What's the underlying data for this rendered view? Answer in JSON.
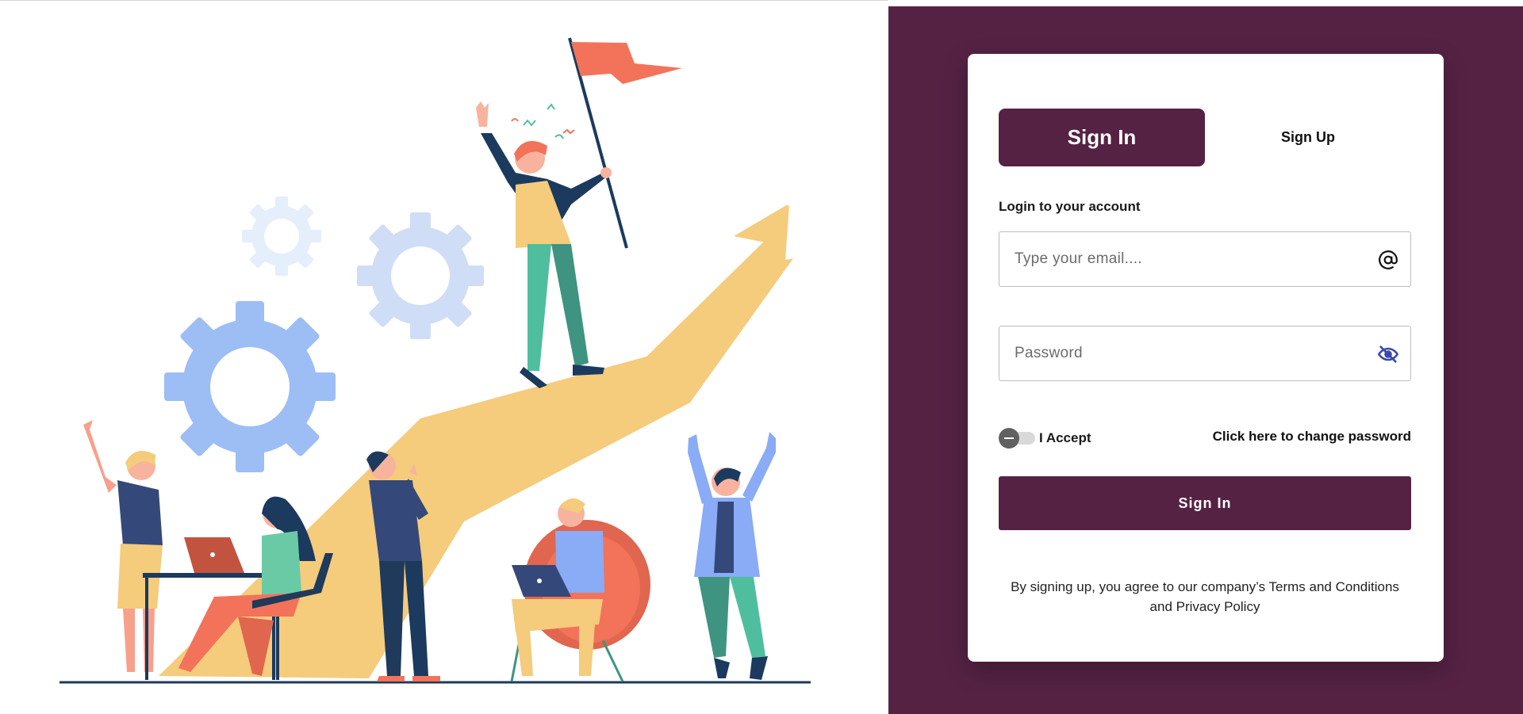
{
  "illustration": {
    "description_icon": "team-celebrating-growth-illustration",
    "colors": {
      "arrow": "#F5CB7C",
      "gear_dark": "#9DBDF5",
      "gear_light": "#CFDDF7",
      "flag": "#F2735A",
      "navy": "#1B3A5E",
      "green": "#4FBE9F",
      "ground": "#1F3A5A"
    }
  },
  "auth_card": {
    "tabs": {
      "sign_in": "Sign In",
      "sign_up": "Sign Up",
      "active": "sign_in"
    },
    "heading": "Login to your account",
    "email": {
      "placeholder": "Type your email....",
      "value": "",
      "icon": "at-icon"
    },
    "password": {
      "placeholder": "Password",
      "value": "",
      "icon": "eye-slash-icon"
    },
    "accept_label": "I Accept",
    "accept_checked": false,
    "change_password_link": "Click here to change password",
    "submit_label": "Sign In",
    "terms_prefix": "By signing up, you agree to our company’s",
    "terms_link": "Terms and Conditions",
    "terms_joiner": "and",
    "privacy_link": "Privacy Policy"
  },
  "colors": {
    "brand": "#552244",
    "card": "#FFFFFF",
    "toggle_knob": "#616161",
    "eye_icon": "#3949AB"
  }
}
